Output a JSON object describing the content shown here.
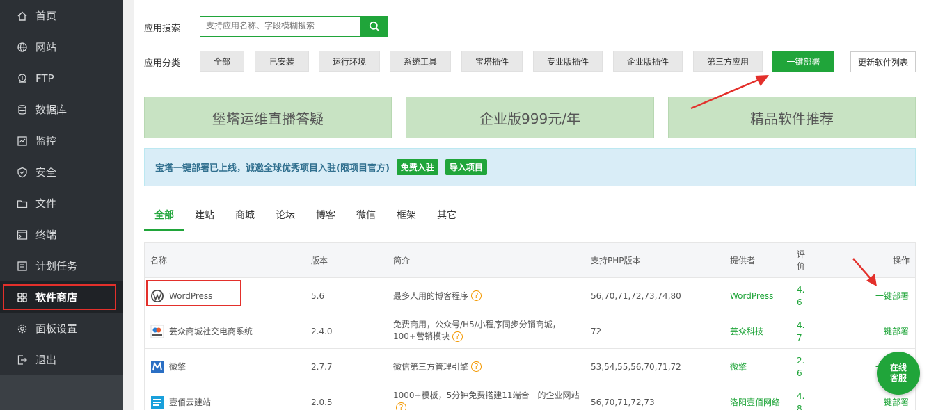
{
  "sidebar": {
    "items": [
      {
        "label": "首页",
        "icon": "home-icon"
      },
      {
        "label": "网站",
        "icon": "globe-icon"
      },
      {
        "label": "FTP",
        "icon": "ftp-icon"
      },
      {
        "label": "数据库",
        "icon": "database-icon"
      },
      {
        "label": "监控",
        "icon": "monitor-icon"
      },
      {
        "label": "安全",
        "icon": "shield-icon"
      },
      {
        "label": "文件",
        "icon": "folder-icon"
      },
      {
        "label": "终端",
        "icon": "terminal-icon"
      },
      {
        "label": "计划任务",
        "icon": "task-list-icon"
      },
      {
        "label": "软件商店",
        "icon": "app-grid-icon"
      },
      {
        "label": "面板设置",
        "icon": "gear-icon"
      },
      {
        "label": "退出",
        "icon": "logout-icon"
      }
    ],
    "active_index": 9
  },
  "search": {
    "label": "应用搜索",
    "placeholder": "支持应用名称、字段模糊搜索"
  },
  "categories": {
    "label": "应用分类",
    "items": [
      "全部",
      "已安装",
      "运行环境",
      "系统工具",
      "宝塔插件",
      "专业版插件",
      "企业版插件",
      "第三方应用",
      "一键部署"
    ],
    "update_label": "更新软件列表"
  },
  "banners": [
    "堡塔运维直播答疑",
    "企业版999元/年",
    "精品软件推荐"
  ],
  "notice": {
    "text": "宝塔一键部署已上线，诚邀全球优秀项目入驻(限项目官方)",
    "btn_join": "免费入驻",
    "btn_import": "导入项目"
  },
  "tabs": [
    "全部",
    "建站",
    "商城",
    "论坛",
    "博客",
    "微信",
    "框架",
    "其它"
  ],
  "table": {
    "headers": {
      "name": "名称",
      "version": "版本",
      "desc": "简介",
      "php": "支持PHP版本",
      "provider": "提供者",
      "score": "评价",
      "action": "操作"
    },
    "rows": [
      {
        "name": "WordPress",
        "version": "5.6",
        "desc": "最多人用的博客程序",
        "php": "56,70,71,72,73,74,80",
        "provider": "WordPress",
        "score": "4.6",
        "action": "一键部署"
      },
      {
        "name": "芸众商城社交电商系统",
        "version": "2.4.0",
        "desc": "免费商用，公众号/H5/小程序同步分销商城，100+营销模块",
        "php": "72",
        "provider": "芸众科技",
        "score": "4.7",
        "action": "一键部署"
      },
      {
        "name": "微擎",
        "version": "2.7.7",
        "desc": "微信第三方管理引擎",
        "php": "53,54,55,56,70,71,72",
        "provider": "微擎",
        "score": "2.6",
        "action": "一键部署"
      },
      {
        "name": "壹佰云建站",
        "version": "2.0.5",
        "desc": "1000+模板，5分钟免费搭建11端合一的企业网站",
        "php": "56,70,71,72,73",
        "provider": "洛阳壹佰网络",
        "score": "4.8",
        "action": "一键部署"
      }
    ]
  },
  "chat": {
    "line1": "在线",
    "line2": "客服"
  },
  "colors": {
    "accent": "#20a53a",
    "highlight": "#e3302b",
    "sidebar": "#2c3035"
  }
}
